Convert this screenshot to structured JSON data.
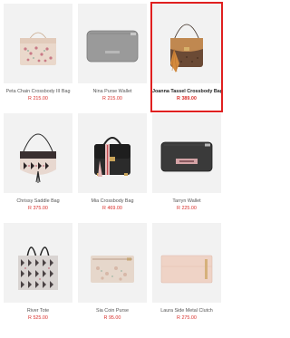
{
  "products": [
    {
      "name": "Peta Chain Crossbody III Bag",
      "price": "R 215.00",
      "selected": false,
      "image": "cream-embroidered-clutch"
    },
    {
      "name": "Nina Purse Wallet",
      "price": "R 215.00",
      "selected": false,
      "image": "grey-zip-wallet"
    },
    {
      "name": "Joanna Tassel Crossbody Bag",
      "price": "R 389.00",
      "selected": true,
      "image": "brown-monogram-crossbody"
    },
    {
      "name": "Chrissy Saddle Bag",
      "price": "R 375.00",
      "selected": false,
      "image": "patterned-saddle-bag"
    },
    {
      "name": "Mia Crossbody Bag",
      "price": "R 469.00",
      "selected": false,
      "image": "black-pink-stripe-crossbody"
    },
    {
      "name": "Tarryn Wallet",
      "price": "R 225.00",
      "selected": false,
      "image": "black-wallet"
    },
    {
      "name": "River Tote",
      "price": "R 525.00",
      "selected": false,
      "image": "printed-tote"
    },
    {
      "name": "Sia Coin Purse",
      "price": "R 95.00",
      "selected": false,
      "image": "cream-coin-purse"
    },
    {
      "name": "Laura Side Metal Clutch",
      "price": "R 275.00",
      "selected": false,
      "image": "blush-clutch"
    }
  ],
  "colors": {
    "selected_border": "#e02020",
    "price": "#d9302c",
    "name": "#555555",
    "thumb_bg": "#f2f2f2"
  }
}
